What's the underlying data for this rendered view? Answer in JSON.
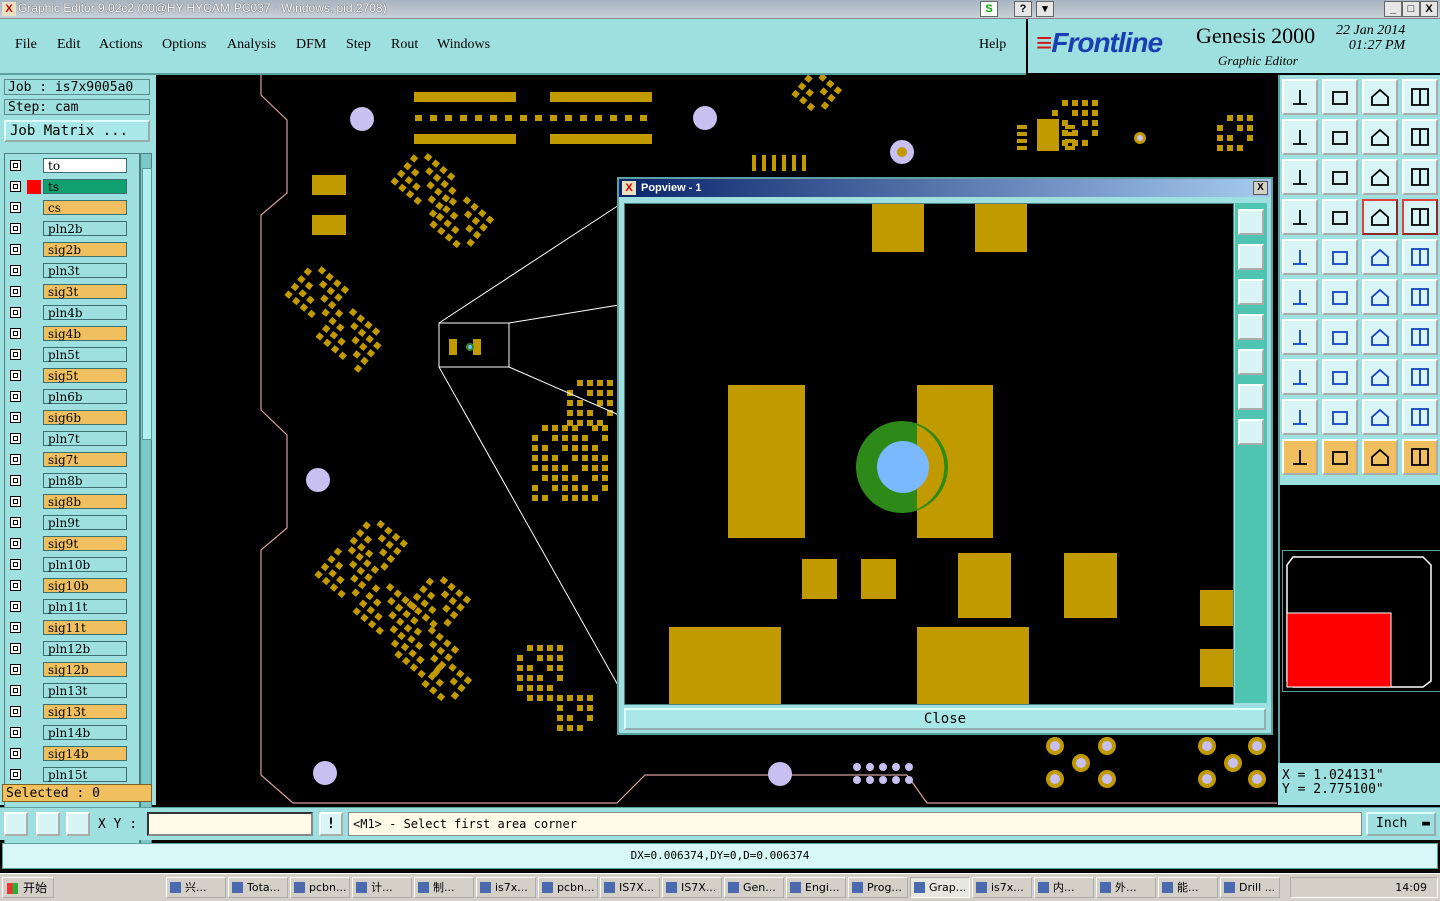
{
  "window": {
    "title": "Graphic Editor 9.02c2 (00@HY-HYCAM-PC037 - Windows, pid:2708)",
    "buttons": [
      "_",
      "□",
      "X"
    ]
  },
  "menu": {
    "items": [
      "File",
      "Edit",
      "Actions",
      "Options",
      "Analysis",
      "DFM",
      "Step",
      "Rout",
      "Windows"
    ],
    "help": "Help"
  },
  "brand": {
    "logo": "Frontline",
    "product": "Genesis 2000",
    "subtitle": "Graphic Editor",
    "date": "22 Jan 2014",
    "time": "01:27 PM"
  },
  "job": {
    "job_label": "Job : is7x9005a0",
    "step_label": "Step: cam",
    "matrix_button": "Job Matrix ..."
  },
  "layers": [
    {
      "name": "to",
      "color": "#ffffff",
      "active": false
    },
    {
      "name": "ts",
      "color": "#10a070",
      "active": true
    },
    {
      "name": "cs",
      "color": "#f0c060",
      "active": false
    },
    {
      "name": "pln2b",
      "color": "#9ee0e0",
      "active": false
    },
    {
      "name": "sig2b",
      "color": "#f0c060",
      "active": false
    },
    {
      "name": "pln3t",
      "color": "#9ee0e0",
      "active": false
    },
    {
      "name": "sig3t",
      "color": "#f0c060",
      "active": false
    },
    {
      "name": "pln4b",
      "color": "#9ee0e0",
      "active": false
    },
    {
      "name": "sig4b",
      "color": "#f0c060",
      "active": false
    },
    {
      "name": "pln5t",
      "color": "#9ee0e0",
      "active": false
    },
    {
      "name": "sig5t",
      "color": "#f0c060",
      "active": false
    },
    {
      "name": "pln6b",
      "color": "#9ee0e0",
      "active": false
    },
    {
      "name": "sig6b",
      "color": "#f0c060",
      "active": false
    },
    {
      "name": "pln7t",
      "color": "#9ee0e0",
      "active": false
    },
    {
      "name": "sig7t",
      "color": "#f0c060",
      "active": false
    },
    {
      "name": "pln8b",
      "color": "#9ee0e0",
      "active": false
    },
    {
      "name": "sig8b",
      "color": "#f0c060",
      "active": false
    },
    {
      "name": "pln9t",
      "color": "#9ee0e0",
      "active": false
    },
    {
      "name": "sig9t",
      "color": "#f0c060",
      "active": false
    },
    {
      "name": "pln10b",
      "color": "#9ee0e0",
      "active": false
    },
    {
      "name": "sig10b",
      "color": "#f0c060",
      "active": false
    },
    {
      "name": "pln11t",
      "color": "#9ee0e0",
      "active": false
    },
    {
      "name": "sig11t",
      "color": "#f0c060",
      "active": false
    },
    {
      "name": "pln12b",
      "color": "#9ee0e0",
      "active": false
    },
    {
      "name": "sig12b",
      "color": "#f0c060",
      "active": false
    },
    {
      "name": "pln13t",
      "color": "#9ee0e0",
      "active": false
    },
    {
      "name": "sig13t",
      "color": "#f0c060",
      "active": false
    },
    {
      "name": "pln14b",
      "color": "#9ee0e0",
      "active": false
    },
    {
      "name": "sig14b",
      "color": "#f0c060",
      "active": false
    },
    {
      "name": "pln15t",
      "color": "#9ee0e0",
      "active": false
    }
  ],
  "selected": "Selected : 0",
  "popup": {
    "title": "Popview - 1",
    "close_label": "Close"
  },
  "coords": {
    "x": "X = 1.024131\"",
    "y": "Y = 2.775100\""
  },
  "cmd": {
    "xy_label": "X Y :",
    "xy_value": "",
    "excl": "!",
    "prompt": "<M1> - Select first area corner",
    "unit": "Inch"
  },
  "status": "DX=0.006374,DY=0,D=0.006374",
  "taskbar": {
    "start": "开始",
    "tasks": [
      "兴...",
      "Tota...",
      "pcbn...",
      "计...",
      "制...",
      "is7x...",
      "pcbn...",
      "IS7X...",
      "IS7X...",
      "Gen...",
      "Engi...",
      "Prog...",
      "Grap...",
      "is7x...",
      "内...",
      "外...",
      "能...",
      "Drill ..."
    ],
    "active_task": "Grap...",
    "clock": "14:09"
  },
  "colors": {
    "panel": "#9ee0e0",
    "copper": "#c19a00",
    "accent": "#f0c060"
  }
}
